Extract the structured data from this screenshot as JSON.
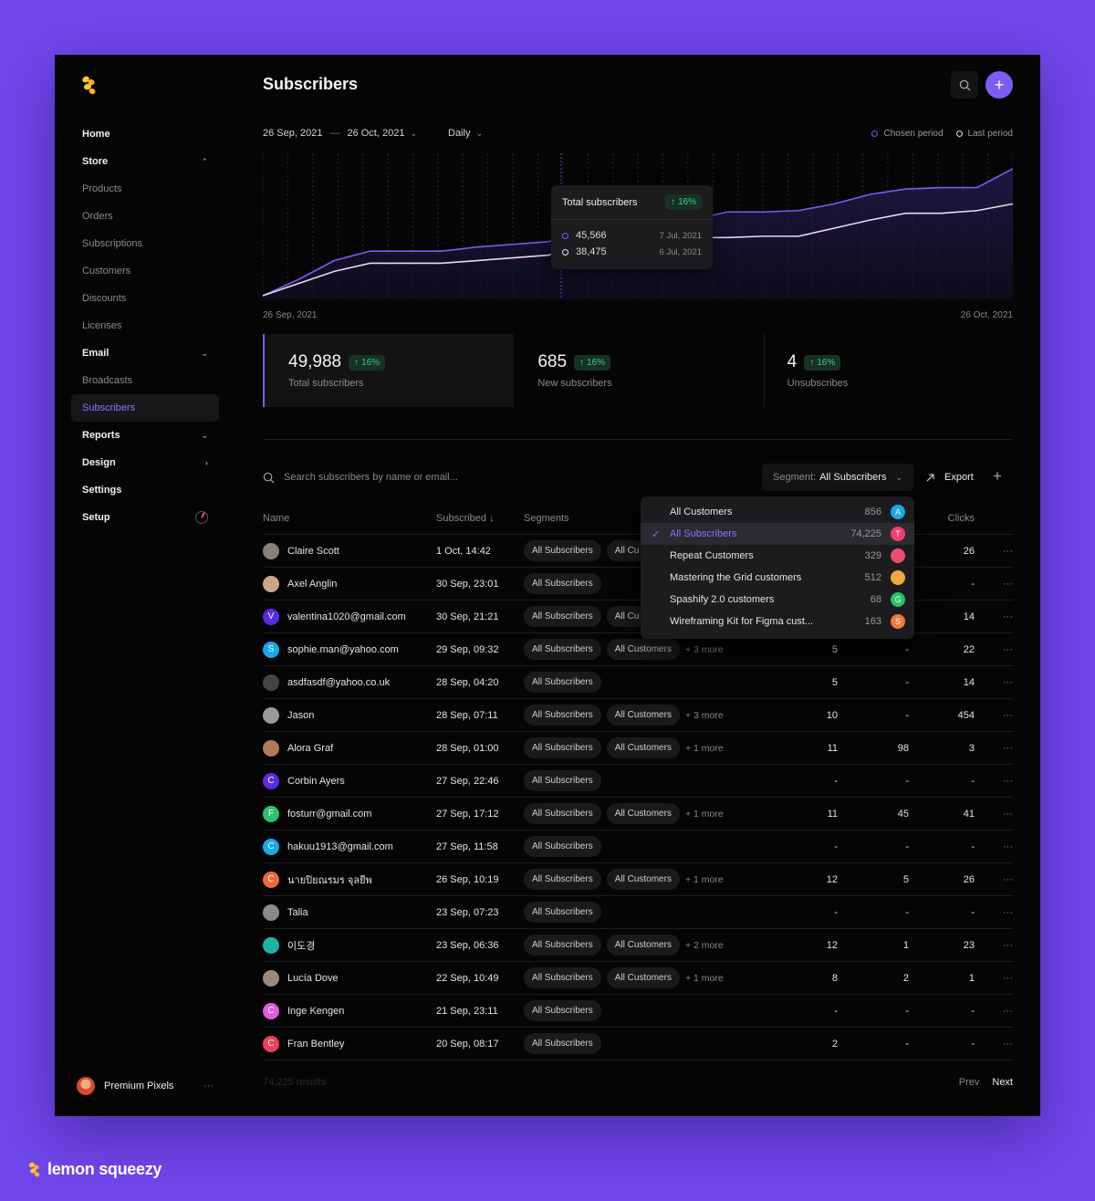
{
  "sidebar": {
    "items": [
      {
        "label": "Home",
        "kind": "top",
        "chevron": ""
      },
      {
        "label": "Store",
        "kind": "top",
        "chevron": "⌃"
      },
      {
        "label": "Products",
        "kind": "sub",
        "chevron": ""
      },
      {
        "label": "Orders",
        "kind": "sub",
        "chevron": ""
      },
      {
        "label": "Subscriptions",
        "kind": "sub",
        "chevron": ""
      },
      {
        "label": "Customers",
        "kind": "sub",
        "chevron": ""
      },
      {
        "label": "Discounts",
        "kind": "sub",
        "chevron": ""
      },
      {
        "label": "Licenses",
        "kind": "sub",
        "chevron": ""
      },
      {
        "label": "Email",
        "kind": "top",
        "chevron": "⌄"
      },
      {
        "label": "Broadcasts",
        "kind": "sub",
        "chevron": ""
      },
      {
        "label": "Subscribers",
        "kind": "sub active",
        "chevron": ""
      },
      {
        "label": "Reports",
        "kind": "top",
        "chevron": "⌄"
      },
      {
        "label": "Design",
        "kind": "top",
        "chevron": "›"
      },
      {
        "label": "Settings",
        "kind": "top",
        "chevron": ""
      },
      {
        "label": "Setup",
        "kind": "top",
        "chevron": "ring"
      }
    ],
    "profile": {
      "name": "Premium Pixels",
      "more": "···"
    }
  },
  "header": {
    "title": "Subscribers"
  },
  "filters": {
    "date_from": "26 Sep, 2021",
    "dash": "—",
    "date_to": "26 Oct, 2021",
    "interval": "Daily"
  },
  "legend": {
    "chosen": "Chosen period",
    "last": "Last period"
  },
  "chart_data": {
    "type": "area",
    "x_start": "26 Sep, 2021",
    "x_end": "26 Oct, 2021",
    "series": [
      {
        "name": "Chosen period",
        "color": "#7c5cf5",
        "values": [
          0,
          0.12,
          0.26,
          0.33,
          0.33,
          0.33,
          0.36,
          0.38,
          0.4,
          0.48,
          0.5,
          0.52,
          0.56,
          0.62,
          0.62,
          0.63,
          0.68,
          0.75,
          0.79,
          0.8,
          0.8,
          0.94
        ]
      },
      {
        "name": "Last period",
        "color": "#f0d8f0",
        "values": [
          0,
          0.09,
          0.18,
          0.24,
          0.24,
          0.24,
          0.26,
          0.28,
          0.3,
          0.38,
          0.4,
          0.41,
          0.43,
          0.43,
          0.44,
          0.44,
          0.5,
          0.56,
          0.61,
          0.61,
          0.63,
          0.68
        ]
      }
    ]
  },
  "tooltip": {
    "title": "Total subscribers",
    "change": "16%",
    "rows": [
      {
        "value": "45,566",
        "date": "7 Jul, 2021"
      },
      {
        "value": "38,475",
        "date": "6 Jul, 2021"
      }
    ]
  },
  "stats": [
    {
      "value": "49,988",
      "change": "16%",
      "label": "Total subscribers"
    },
    {
      "value": "685",
      "change": "16%",
      "label": "New subscribers"
    },
    {
      "value": "4",
      "change": "16%",
      "label": "Unsubscribes"
    }
  ],
  "toolbar": {
    "search_placeholder": "Search subscribers by name or email...",
    "segment_label": "Segment:",
    "segment_value": "All Subscribers",
    "export_label": "Export"
  },
  "table": {
    "columns": [
      "Name",
      "Subscribed ↓",
      "Segments",
      "",
      "",
      "Clicks"
    ],
    "rows": [
      {
        "name": "Claire Scott",
        "avatar": "",
        "color": "#8a7f7a",
        "subscribed": "1 Oct, 14:42",
        "segments": [
          "All Subscribers",
          "All Cu"
        ],
        "more": "",
        "n1": "",
        "n2": "",
        "n3": "26"
      },
      {
        "name": "Axel Anglin",
        "avatar": "",
        "color": "#c9a58a",
        "subscribed": "30 Sep, 23:01",
        "segments": [
          "All Subscribers"
        ],
        "more": "",
        "n1": "",
        "n2": "",
        "n3": "-"
      },
      {
        "name": "valentina1020@gmail.com",
        "avatar": "V",
        "color": "#5b2be0",
        "subscribed": "30 Sep, 21:21",
        "segments": [
          "All Subscribers",
          "All Cu"
        ],
        "more": "",
        "n1": "",
        "n2": "",
        "n3": "14"
      },
      {
        "name": "sophie.man@yahoo.com",
        "avatar": "S",
        "color": "#1aa7ec",
        "subscribed": "29 Sep, 09:32",
        "segments": [
          "All Subscribers",
          "All Customers"
        ],
        "more": "+ 3 more",
        "n1": "5",
        "n2": "-",
        "n3": "22"
      },
      {
        "name": "asdfasdf@yahoo.co.uk",
        "avatar": "",
        "color": "#444444",
        "subscribed": "28 Sep, 04:20",
        "segments": [
          "All Subscribers"
        ],
        "more": "",
        "n1": "5",
        "n2": "-",
        "n3": "14"
      },
      {
        "name": "Jason",
        "avatar": "",
        "color": "#9a9a9a",
        "subscribed": "28 Sep, 07:11",
        "segments": [
          "All Subscribers",
          "All Customers"
        ],
        "more": "+ 3 more",
        "n1": "10",
        "n2": "-",
        "n3": "454"
      },
      {
        "name": "Alora Graf",
        "avatar": "",
        "color": "#b07a5a",
        "subscribed": "28 Sep, 01:00",
        "segments": [
          "All Subscribers",
          "All Customers"
        ],
        "more": "+ 1 more",
        "n1": "11",
        "n2": "98",
        "n3": "3"
      },
      {
        "name": "Corbin Ayers",
        "avatar": "C",
        "color": "#5b2be0",
        "subscribed": "27 Sep, 22:46",
        "segments": [
          "All Subscribers"
        ],
        "more": "",
        "n1": "-",
        "n2": "-",
        "n3": "-"
      },
      {
        "name": "fosturr@gmail.com",
        "avatar": "F",
        "color": "#2cc26b",
        "subscribed": "27 Sep, 17:12",
        "segments": [
          "All Subscribers",
          "All Customers"
        ],
        "more": "+ 1 more",
        "n1": "11",
        "n2": "45",
        "n3": "41"
      },
      {
        "name": "hakuu1913@gmail.com",
        "avatar": "C",
        "color": "#1aa7ec",
        "subscribed": "27 Sep, 11:58",
        "segments": [
          "All Subscribers"
        ],
        "more": "",
        "n1": "-",
        "n2": "-",
        "n3": "-"
      },
      {
        "name": "นายปิยณรมร จุลยีพ",
        "avatar": "C",
        "color": "#f0683a",
        "subscribed": "26 Sep, 10:19",
        "segments": [
          "All Subscribers",
          "All Customers"
        ],
        "more": "+ 1 more",
        "n1": "12",
        "n2": "5",
        "n3": "26"
      },
      {
        "name": "Talia",
        "avatar": "",
        "color": "#8a8a8a",
        "subscribed": "23 Sep, 07:23",
        "segments": [
          "All Subscribers"
        ],
        "more": "",
        "n1": "-",
        "n2": "-",
        "n3": "-"
      },
      {
        "name": "이도경",
        "avatar": "",
        "color": "#1fb3a8",
        "subscribed": "23 Sep, 06:36",
        "segments": [
          "All Subscribers",
          "All Customers"
        ],
        "more": "+ 2 more",
        "n1": "12",
        "n2": "1",
        "n3": "23"
      },
      {
        "name": "Lucía Dove",
        "avatar": "",
        "color": "#9c8a7a",
        "subscribed": "22 Sep, 10:49",
        "segments": [
          "All Subscribers",
          "All Customers"
        ],
        "more": "+ 1 more",
        "n1": "8",
        "n2": "2",
        "n3": "1"
      },
      {
        "name": "Inge Kengen",
        "avatar": "C",
        "color": "#e35be0",
        "subscribed": "21 Sep, 23:11",
        "segments": [
          "All Subscribers"
        ],
        "more": "",
        "n1": "-",
        "n2": "-",
        "n3": "-"
      },
      {
        "name": "Fran Bentley",
        "avatar": "C",
        "color": "#ef3f5a",
        "subscribed": "20 Sep, 08:17",
        "segments": [
          "All Subscribers"
        ],
        "more": "",
        "n1": "2",
        "n2": "-",
        "n3": "-"
      }
    ],
    "row_more": "···"
  },
  "dropdown": {
    "items": [
      {
        "label": "All Customers",
        "count": "856",
        "avatar": "A",
        "color": "#1aa7ec",
        "selected": false
      },
      {
        "label": "All Subscribers",
        "count": "74,225",
        "avatar": "T",
        "color": "#ef3f70",
        "selected": true
      },
      {
        "label": "Repeat Customers",
        "count": "329",
        "avatar": "",
        "color": "#e8506e",
        "selected": false
      },
      {
        "label": "Mastering the Grid customers",
        "count": "512",
        "avatar": "",
        "color": "#f0a93a",
        "selected": false
      },
      {
        "label": "Spashify 2.0 customers",
        "count": "68",
        "avatar": "G",
        "color": "#2cc26b",
        "selected": false
      },
      {
        "label": "Wireframing Kit for Figma cust...",
        "count": "163",
        "avatar": "S",
        "color": "#f07a3a",
        "selected": false
      }
    ]
  },
  "footer": {
    "results": "74,225 results",
    "prev": "Prev",
    "next": "Next"
  },
  "brand": {
    "name": "lemon squeezy"
  }
}
